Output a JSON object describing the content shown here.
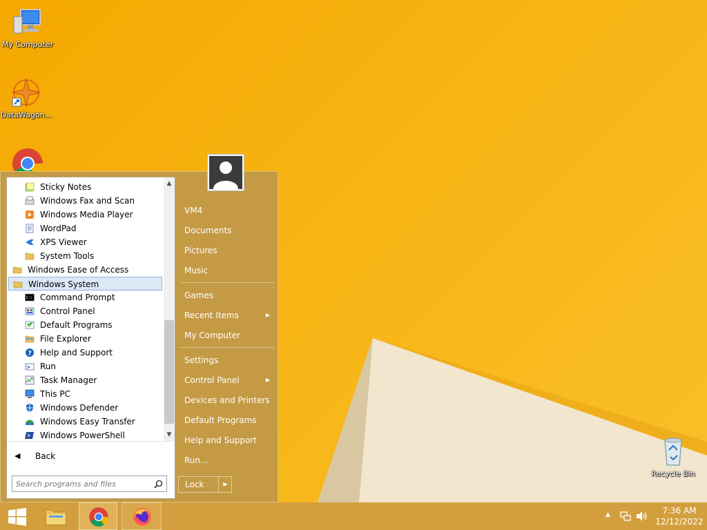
{
  "desktop": {
    "icons": [
      {
        "name": "my-computer",
        "label": "My Computer"
      },
      {
        "name": "datawagon",
        "label": "DataWagon..."
      },
      {
        "name": "recycle-bin",
        "label": "Recycle Bin"
      }
    ]
  },
  "start_menu": {
    "programs": [
      {
        "label": "Sticky Notes",
        "icon": "sticky-notes-icon"
      },
      {
        "label": "Windows Fax and Scan",
        "icon": "fax-icon"
      },
      {
        "label": "Windows Media Player",
        "icon": "media-player-icon"
      },
      {
        "label": "WordPad",
        "icon": "wordpad-icon"
      },
      {
        "label": "XPS Viewer",
        "icon": "xps-viewer-icon"
      },
      {
        "label": "System Tools",
        "icon": "folder-icon"
      },
      {
        "label": "Windows Ease of Access",
        "icon": "folder-icon"
      },
      {
        "label": "Windows System",
        "icon": "folder-icon",
        "selected": true
      },
      {
        "label": "Command Prompt",
        "icon": "command-prompt-icon"
      },
      {
        "label": "Control Panel",
        "icon": "control-panel-icon"
      },
      {
        "label": "Default Programs",
        "icon": "default-programs-icon"
      },
      {
        "label": "File Explorer",
        "icon": "file-explorer-icon"
      },
      {
        "label": "Help and Support",
        "icon": "help-icon"
      },
      {
        "label": "Run",
        "icon": "run-icon"
      },
      {
        "label": "Task Manager",
        "icon": "task-manager-icon"
      },
      {
        "label": "This PC",
        "icon": "this-pc-icon"
      },
      {
        "label": "Windows Defender",
        "icon": "defender-icon"
      },
      {
        "label": "Windows Easy Transfer",
        "icon": "easy-transfer-icon"
      },
      {
        "label": "Windows PowerShell",
        "icon": "powershell-icon"
      }
    ],
    "back_label": "Back",
    "search_placeholder": "Search programs and files",
    "right_items": [
      {
        "label": "VM4"
      },
      {
        "label": "Documents"
      },
      {
        "label": "Pictures"
      },
      {
        "label": "Music"
      },
      {
        "label": "Games"
      },
      {
        "label": "Recent Items",
        "submenu": true
      },
      {
        "label": "My Computer"
      },
      {
        "label": "Settings"
      },
      {
        "label": "Control Panel",
        "submenu": true
      },
      {
        "label": "Devices and Printers"
      },
      {
        "label": "Default Programs"
      },
      {
        "label": "Help and Support"
      },
      {
        "label": "Run..."
      }
    ],
    "lock_label": "Lock"
  },
  "taskbar": {
    "buttons": [
      {
        "name": "start-button",
        "icon": "windows-logo-icon"
      },
      {
        "name": "file-explorer-taskbar-button",
        "icon": "folder-icon"
      },
      {
        "name": "chrome-taskbar-button",
        "icon": "chrome-icon"
      },
      {
        "name": "firefox-taskbar-button",
        "icon": "firefox-icon"
      }
    ],
    "clock": {
      "time": "7:36 AM",
      "date": "12/12/2022"
    }
  },
  "colors": {
    "wallpaper": "#f5a800",
    "menu_bg": "#c49a45",
    "taskbar_bg": "#d39f3e",
    "selection": "#dbe8f5"
  }
}
